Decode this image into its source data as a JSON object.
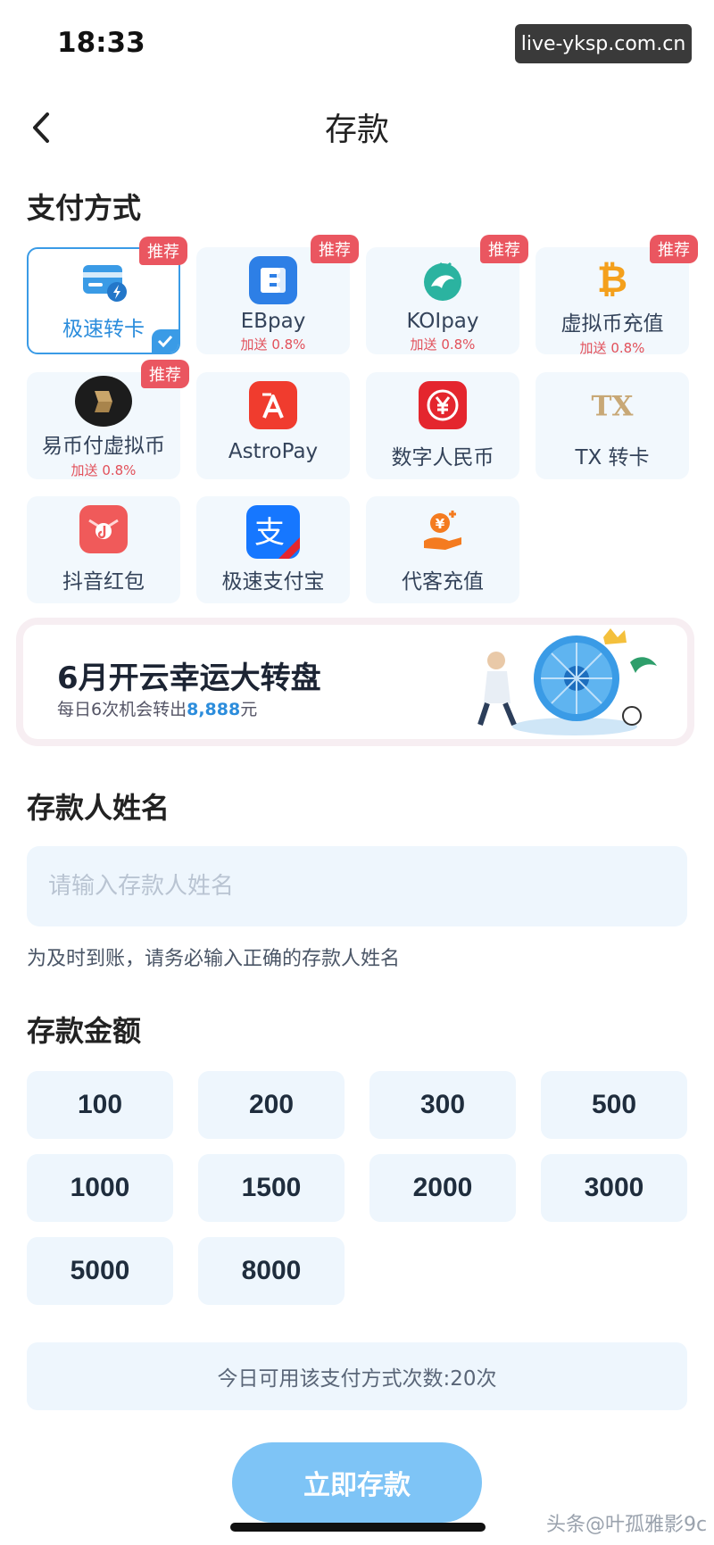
{
  "status_bar": {
    "time": "18:33",
    "watermark": "live-yksp.com.cn"
  },
  "header": {
    "title": "存款"
  },
  "payment": {
    "section_title": "支付方式",
    "recommend_label": "推荐",
    "methods": [
      {
        "label": "极速转卡",
        "bonus": "",
        "recommended": true,
        "icon": "card-icon"
      },
      {
        "label": "EBpay",
        "bonus": "加送 0.8%",
        "recommended": true,
        "icon": "ebpay-icon"
      },
      {
        "label": "KOIpay",
        "bonus": "加送 0.8%",
        "recommended": true,
        "icon": "koi-fish-icon"
      },
      {
        "label": "虚拟币充值",
        "bonus": "加送 0.8%",
        "recommended": true,
        "icon": "bitcoin-icon"
      },
      {
        "label": "易币付虚拟币",
        "bonus": "加送 0.8%",
        "recommended": true,
        "icon": "ebifu-icon"
      },
      {
        "label": "AstroPay",
        "bonus": "",
        "recommended": false,
        "icon": "astropay-icon"
      },
      {
        "label": "数字人民币",
        "bonus": "",
        "recommended": false,
        "icon": "digital-rmb-icon"
      },
      {
        "label": "TX 转卡",
        "bonus": "",
        "recommended": false,
        "icon": "tx-icon"
      },
      {
        "label": "抖音红包",
        "bonus": "",
        "recommended": false,
        "icon": "douyin-redpacket-icon"
      },
      {
        "label": "极速支付宝",
        "bonus": "",
        "recommended": false,
        "icon": "alipay-icon"
      },
      {
        "label": "代客充值",
        "bonus": "",
        "recommended": false,
        "icon": "agent-topup-icon"
      }
    ],
    "selected_index": 0
  },
  "banner": {
    "title": "6月开云幸运大转盘",
    "subtitle_prefix": "每日6次机会转出",
    "subtitle_amount": "8,888",
    "subtitle_suffix": "元"
  },
  "depositor": {
    "section_title": "存款人姓名",
    "placeholder": "请输入存款人姓名",
    "value": "",
    "hint": "为及时到账，请务必输入正确的存款人姓名"
  },
  "amount": {
    "section_title": "存款金额",
    "options": [
      "100",
      "200",
      "300",
      "500",
      "1000",
      "1500",
      "2000",
      "3000",
      "5000",
      "8000"
    ]
  },
  "usage_text": "今日可用该支付方式次数:20次",
  "submit_label": "立即存款",
  "bottom_watermark": "头条@叶孤雅影9c",
  "colors": {
    "accent": "#3a9be6",
    "badge": "#ea5660",
    "submit": "#7ec4f6",
    "card_bg": "#f2f8fd"
  }
}
